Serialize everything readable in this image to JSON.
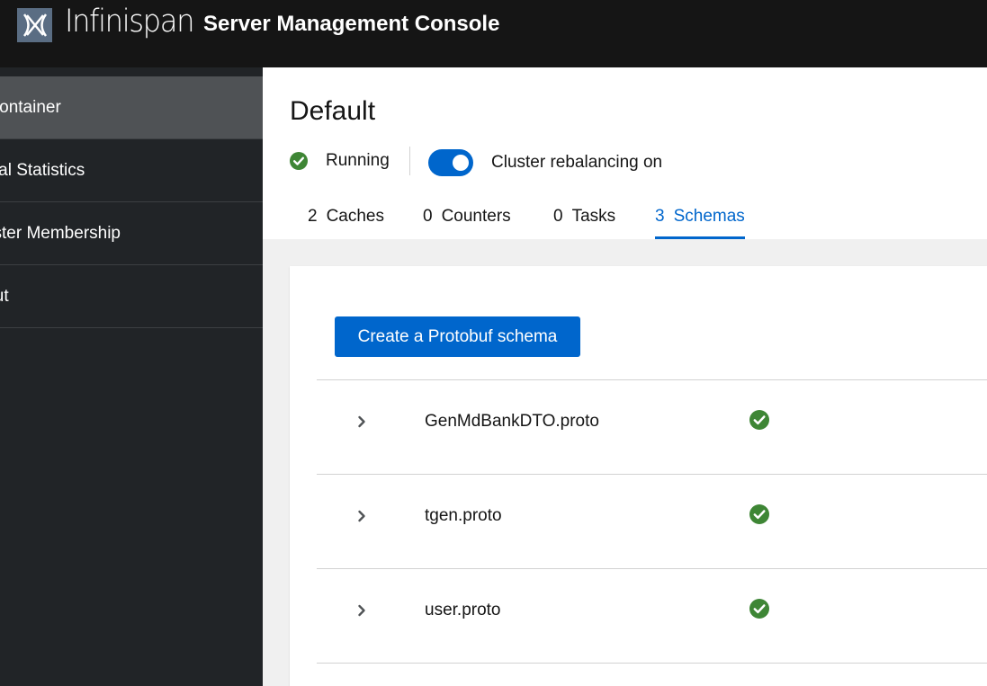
{
  "header": {
    "logo_text": "Infinispan",
    "title": "Server Management Console"
  },
  "sidebar": {
    "items": [
      {
        "label": "Data Container",
        "icon": "none",
        "active": true
      },
      {
        "label": "Global Statistics",
        "active": false
      },
      {
        "label": "Cluster Membership",
        "active": false
      },
      {
        "label": "About",
        "active": false
      }
    ]
  },
  "main": {
    "title": "Default",
    "status": "Running",
    "rebalancing_label": "Cluster rebalancing on",
    "rebalancing_on": true,
    "tabs": [
      {
        "count": "2",
        "label": "Caches"
      },
      {
        "count": "0",
        "label": "Counters"
      },
      {
        "count": "0",
        "label": "Tasks"
      },
      {
        "count": "3",
        "label": "Schemas",
        "active": true
      }
    ],
    "create_button": "Create a Protobuf schema",
    "schemas": [
      {
        "name": "GenMdBankDTO.proto",
        "status": "check-circle-icon"
      },
      {
        "name": "tgen.proto",
        "status": "check-circle-icon"
      },
      {
        "name": "user.proto",
        "status": "check-circle-icon"
      }
    ]
  },
  "colors": {
    "accent": "#0066cc",
    "success": "#3e8635",
    "masthead": "#151515",
    "sidebar": "#212427",
    "sidebar_active": "#4f5255"
  }
}
